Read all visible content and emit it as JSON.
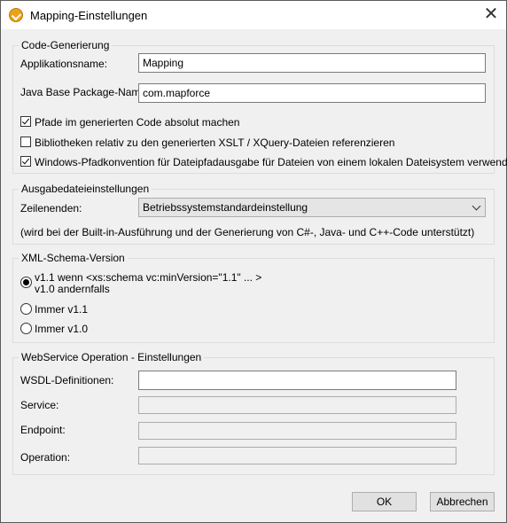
{
  "window": {
    "title": "Mapping-Einstellungen",
    "app_icon": "mapforce-icon",
    "close_icon": "close-icon",
    "close_glyph": "✕"
  },
  "code_generation": {
    "legend": "Code-Generierung",
    "app_name_label": "Applikationsname:",
    "app_name_value": "Mapping",
    "package_label": "Java Base Package-Name:",
    "package_value": "com.mapforce",
    "options": [
      {
        "label": "Pfade im generierten Code absolut machen",
        "checked": true
      },
      {
        "label": "Bibliotheken relativ zu den generierten XSLT / XQuery-Dateien referenzieren",
        "checked": false
      },
      {
        "label": "Windows-Pfadkonvention für Dateipfadausgabe für Dateien von einem lokalen Dateisystem verwenden",
        "checked": true
      }
    ]
  },
  "output_settings": {
    "legend": "Ausgabedateieinstellungen",
    "line_endings_label": "Zeilenenden:",
    "line_endings_value": "Betriebssystemstandardeinstellung",
    "note": "(wird bei der Built-in-Ausführung und der Generierung von C#-, Java- und C++-Code unterstützt)"
  },
  "xml_schema": {
    "legend": "XML-Schema-Version",
    "options": [
      {
        "line1": "v1.1 wenn <xs:schema vc:minVersion=\"1.1\" ... >",
        "line2": "v1.0 andernfalls",
        "selected": true
      },
      {
        "line1": "Immer v1.1",
        "selected": false
      },
      {
        "line1": "Immer v1.0",
        "selected": false
      }
    ]
  },
  "webservice": {
    "legend": "WebService Operation - Einstellungen",
    "wsdl_label": "WSDL-Definitionen:",
    "wsdl_value": "",
    "service_label": "Service:",
    "service_value": "",
    "endpoint_label": "Endpoint:",
    "endpoint_value": "",
    "operation_label": "Operation:",
    "operation_value": ""
  },
  "buttons": {
    "ok": "OK",
    "cancel": "Abbrechen"
  }
}
